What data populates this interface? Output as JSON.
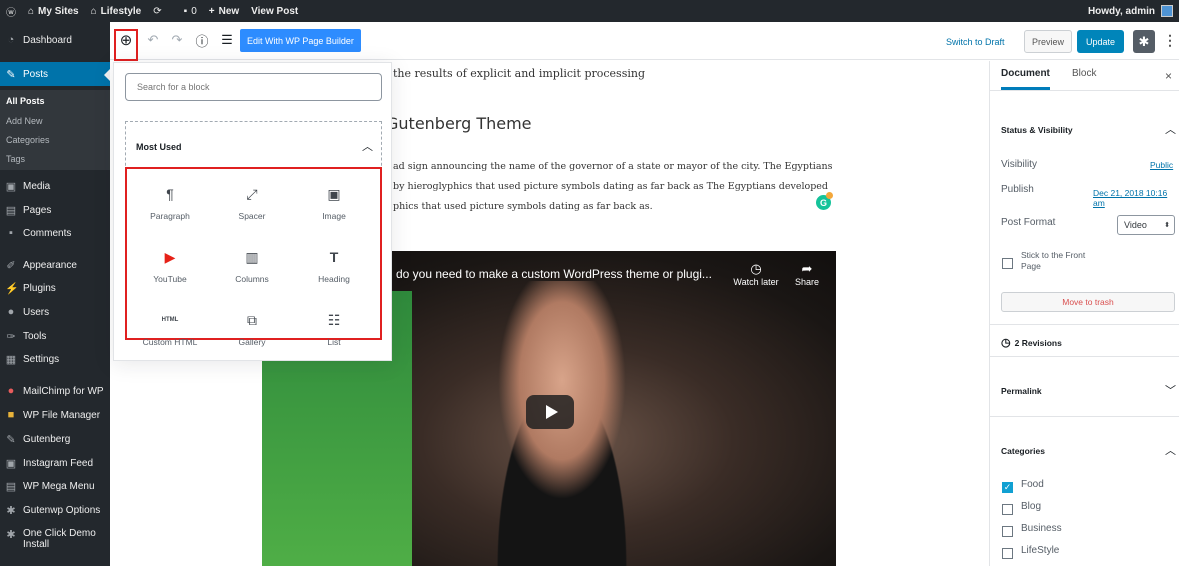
{
  "admin_bar": {
    "my_sites": "My Sites",
    "site": "Lifestyle",
    "comments_count": "0",
    "new": "New",
    "view_post": "View Post",
    "howdy": "Howdy, admin"
  },
  "sidebar": {
    "dashboard": "Dashboard",
    "posts": "Posts",
    "posts_sub": [
      "All Posts",
      "Add New",
      "Categories",
      "Tags"
    ],
    "media": "Media",
    "pages": "Pages",
    "comments": "Comments",
    "appearance": "Appearance",
    "plugins": "Plugins",
    "users": "Users",
    "tools": "Tools",
    "settings": "Settings",
    "mailchimp": "MailChimp for WP",
    "wp_file_manager": "WP File Manager",
    "gutenberg": "Gutenberg",
    "instagram": "Instagram Feed",
    "mega_menu": "WP Mega Menu",
    "gutenwp": "Gutenwp Options",
    "one_click_1": "One Click Demo",
    "one_click_2": "Install"
  },
  "toolbar": {
    "page_builder": "Edit With WP Page Builder",
    "switch_draft": "Switch to Draft",
    "preview": "Preview",
    "update": "Update"
  },
  "content": {
    "line1": "the results of explicit and implicit processing",
    "heading": "Gutenberg Theme",
    "para1": "ad sign announcing the name of the governor of a state or mayor of the city. The Egyptians",
    "para2": "by hieroglyphics that used picture symbols dating as far back as The Egyptians developed",
    "para3": "phics that used picture symbols dating as far back as.",
    "video_title": "do you need to make a custom WordPress theme or plugi...",
    "watch_later": "Watch later",
    "share": "Share"
  },
  "inserter": {
    "search_placeholder": "Search for a block",
    "most_used": "Most Used",
    "blocks": [
      "Paragraph",
      "Spacer",
      "Image",
      "YouTube",
      "Columns",
      "Heading",
      "Custom HTML",
      "Gallery",
      "List"
    ],
    "html_icon_text": "HTML"
  },
  "panel": {
    "tab_document": "Document",
    "tab_block": "Block",
    "status_visibility": "Status & Visibility",
    "visibility_label": "Visibility",
    "visibility_value": "Public",
    "publish_label": "Publish",
    "publish_value": "Dec 21, 2018 10:16 am",
    "post_format_label": "Post Format",
    "post_format_value": "Video",
    "stick_1": "Stick to the Front",
    "stick_2": "Page",
    "move_trash": "Move to trash",
    "revisions": "2 Revisions",
    "permalink": "Permalink",
    "categories": "Categories",
    "category_items": [
      "Food",
      "Blog",
      "Business",
      "LifeStyle"
    ]
  }
}
